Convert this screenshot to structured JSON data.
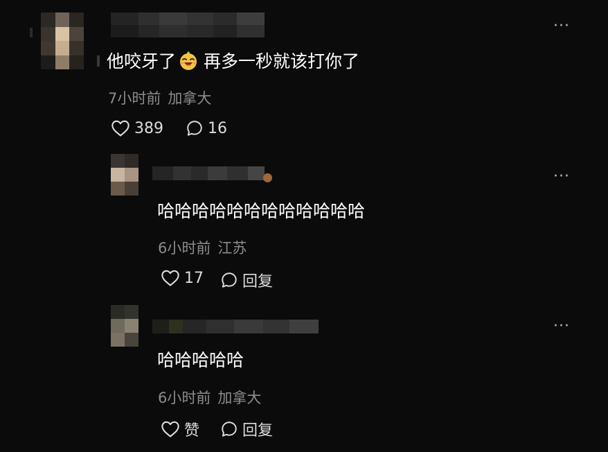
{
  "comments": [
    {
      "text_before": "他咬牙了",
      "emoji": "laughing-face-emoji",
      "text_after": "再多一秒就该打你了",
      "time": "7小时前",
      "location": "加拿大",
      "likes": "389",
      "replies": "16"
    }
  ],
  "replies": [
    {
      "text": "哈哈哈哈哈哈哈哈哈哈哈哈",
      "time": "6小时前",
      "location": "江苏",
      "likes": "17",
      "reply_label": "回复"
    },
    {
      "text": "哈哈哈哈哈",
      "time": "6小时前",
      "location": "加拿大",
      "like_label": "赞",
      "reply_label": "回复"
    }
  ],
  "more_label": "···",
  "icons": {
    "like": "heart-outline-icon",
    "comment": "speech-bubble-icon",
    "more": "more-dots-icon"
  },
  "colors": {
    "background": "#0b0b0b",
    "text": "#ffffff",
    "meta": "#8c8c8c"
  }
}
